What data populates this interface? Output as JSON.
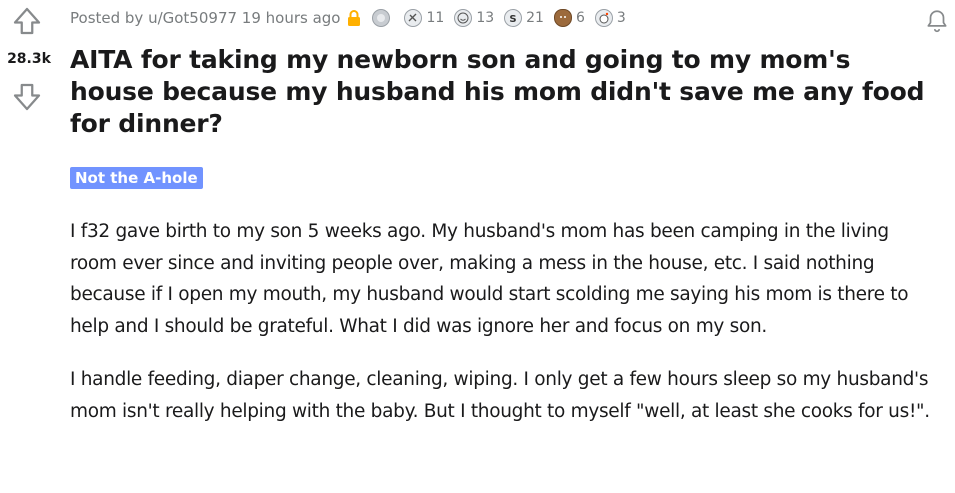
{
  "vote": {
    "count": "28.3k"
  },
  "meta": {
    "posted_by": "Posted by u/Got50977 19 hours ago",
    "awards": [
      {
        "icon": "silver-award-icon",
        "count": "11"
      },
      {
        "icon": "helpful-award-icon",
        "count": "13"
      },
      {
        "icon": "s-award-icon",
        "count": "21"
      },
      {
        "icon": "bear-award-icon",
        "count": "6"
      },
      {
        "icon": "wholesome-award-icon",
        "count": "3"
      }
    ]
  },
  "post": {
    "title": "AITA for taking my newborn son and going to my mom's house because my husband his mom didn't save me any food for dinner?",
    "flair": "Not the A-hole",
    "paragraphs": [
      "I f32 gave birth to my son 5 weeks ago. My husband's mom has been camping in the living room ever since and inviting people over, making a mess in the house, etc. I said nothing because if I open my mouth, my husband would start scolding me saying his mom is there to help and I should be grateful. What I did was ignore her and focus on my son.",
      "I handle feeding, diaper change, cleaning, wiping. I only get a few hours sleep so my husband's mom isn't really helping with the baby. But I thought to myself \"well, at least she cooks for us!\"."
    ]
  },
  "colors": {
    "flair_bg": "#7193ff",
    "meta_text": "#787c7e",
    "lock": "#ffb000"
  }
}
